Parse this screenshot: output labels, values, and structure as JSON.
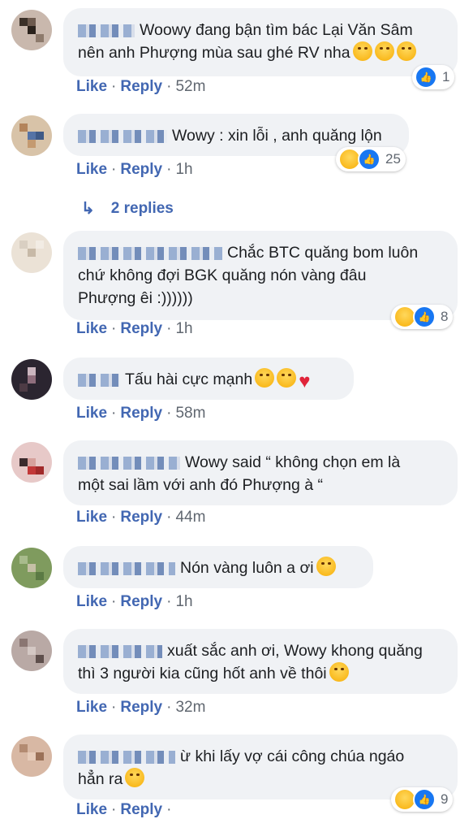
{
  "comments": [
    {
      "text_lines": [
        "Woowy đang bận tìm bác Lại Văn Sâm",
        "nên anh Phượng mùa sau ghé RV nha"
      ],
      "emojis": [
        "haha-emoji",
        "haha-emoji",
        "haha-emoji"
      ],
      "like": "Like",
      "reply": "Reply",
      "time": "52m",
      "reaction_count": "1",
      "reaction_icons": [
        "like-icon"
      ]
    },
    {
      "text_lines": [
        "Wowy : xin lỗi , anh quăng lộn"
      ],
      "like": "Like",
      "reply": "Reply",
      "time": "1h",
      "reaction_count": "25",
      "reaction_icons": [
        "haha-icon",
        "like-icon"
      ],
      "replies_label": "2 replies"
    },
    {
      "text_lines": [
        "Chắc BTC quăng bom luôn",
        "chứ không đợi BGK quăng nón vàng đâu",
        "Phượng êi :))))))"
      ],
      "like": "Like",
      "reply": "Reply",
      "time": "1h",
      "reaction_count": "8",
      "reaction_icons": [
        "haha-icon",
        "like-icon"
      ]
    },
    {
      "text_lines": [
        "Tấu hài cực mạnh"
      ],
      "emojis": [
        "rofl-emoji",
        "rofl-emoji",
        "heart-emoji"
      ],
      "like": "Like",
      "reply": "Reply",
      "time": "58m"
    },
    {
      "text_lines": [
        "Wowy said “ không chọn em là",
        "một sai lầm với anh đó Phượng à “"
      ],
      "like": "Like",
      "reply": "Reply",
      "time": "44m"
    },
    {
      "text_lines": [
        "Nón vàng luôn a ơi"
      ],
      "emojis": [
        "laughing-emoji"
      ],
      "like": "Like",
      "reply": "Reply",
      "time": "1h"
    },
    {
      "text_lines": [
        "xuất sắc anh ơi, Wowy khong quăng",
        "thì 3 người kia cũng hốt anh về thôi"
      ],
      "emojis": [
        "smile-emoji"
      ],
      "like": "Like",
      "reply": "Reply",
      "time": "32m"
    },
    {
      "text_lines": [
        "ừ khi lấy vợ cái công chúa ngáo",
        "hẳn ra"
      ],
      "emojis": [
        "laughing-emoji"
      ],
      "like": "Like",
      "reply": "Reply",
      "time": "",
      "reaction_count": "9",
      "reaction_icons": [
        "haha-icon",
        "like-icon"
      ]
    }
  ],
  "colors": {
    "link": "#4267b2",
    "bubble": "#f0f2f5",
    "meta": "#606770",
    "like": "#1877f2"
  }
}
